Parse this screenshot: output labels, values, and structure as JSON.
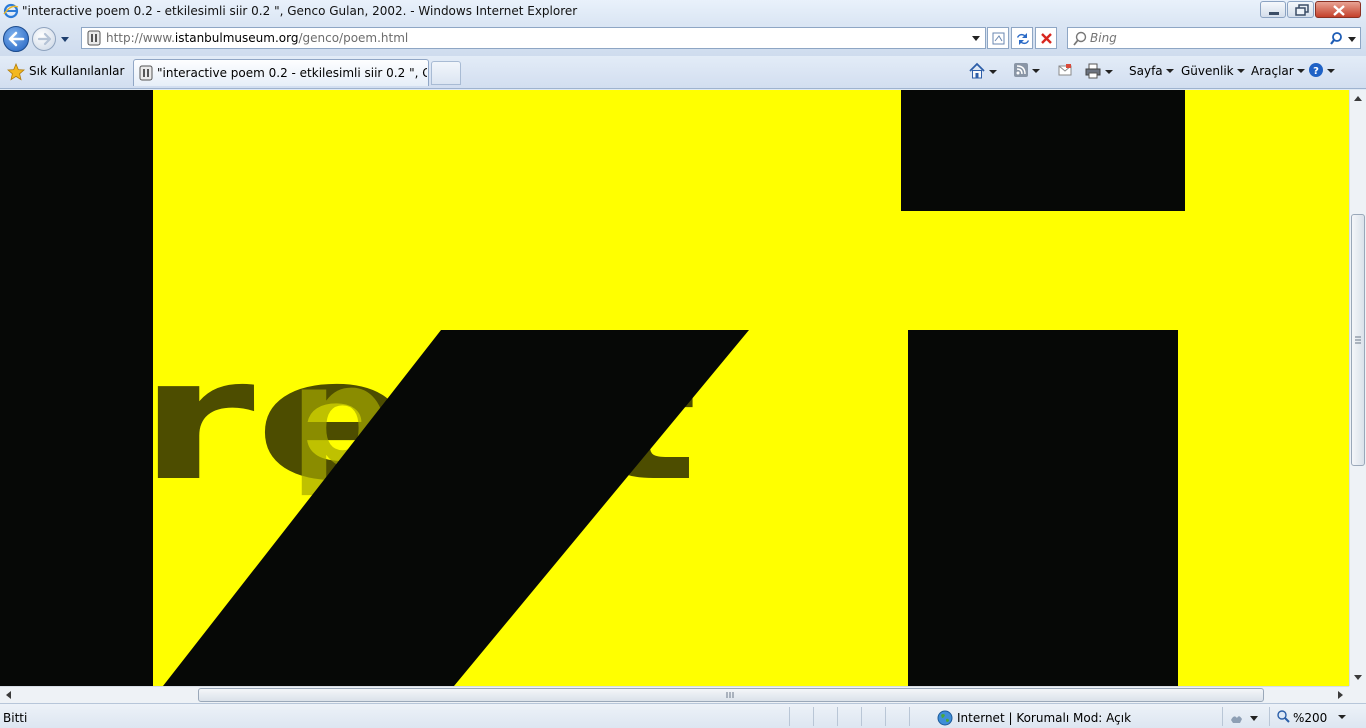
{
  "window": {
    "title": "\"interactive poem 0.2 - etkilesimli siir 0.2 \", Genco Gulan, 2002. - Windows Internet Explorer"
  },
  "address": {
    "url_prefix": "http://www.",
    "url_domain": "istanbulmuseum.org",
    "url_path": "/genco/poem.html"
  },
  "search": {
    "placeholder": "Bing"
  },
  "favorites": {
    "label": "Sık Kullanılanlar"
  },
  "tabs": [
    {
      "label": "\"interactive poem 0.2 - etkilesimli siir 0.2 \", Genco..."
    }
  ],
  "commandbar": {
    "page_label": "Sayfa",
    "safety_label": "Güvenlik",
    "tools_label": "Araçlar"
  },
  "content": {
    "background_color": "#ffff00",
    "shape_color": "#060806",
    "ghost_text": "rept",
    "ghost_text_color": "#4d4d00"
  },
  "status": {
    "text": "Bitti",
    "zone": "Internet | Korumalı Mod: Açık",
    "zoom": "%200"
  }
}
